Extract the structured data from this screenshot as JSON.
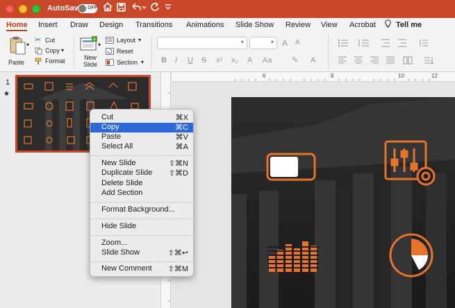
{
  "titlebar": {
    "autosave_label": "AutoSave",
    "toggle_state": "OFF"
  },
  "tabs": [
    {
      "label": "Home",
      "active": true
    },
    {
      "label": "Insert"
    },
    {
      "label": "Draw"
    },
    {
      "label": "Design"
    },
    {
      "label": "Transitions"
    },
    {
      "label": "Animations"
    },
    {
      "label": "Slide Show"
    },
    {
      "label": "Review"
    },
    {
      "label": "View"
    },
    {
      "label": "Acrobat"
    },
    {
      "label": "Tell me"
    }
  ],
  "ribbon": {
    "paste": "Paste",
    "cut": "Cut",
    "copy": "Copy",
    "format": "Format",
    "new_slide": "New",
    "new_slide_2": "Slide",
    "layout": "Layout",
    "reset": "Reset",
    "section": "Section"
  },
  "ruler": {
    "marks": [
      "6",
      "8",
      "10",
      "12"
    ]
  },
  "pane": {
    "slide_number": "1",
    "star": "★"
  },
  "context_menu": {
    "items": [
      {
        "label": "Cut",
        "shortcut": "⌘X"
      },
      {
        "label": "Copy",
        "shortcut": "⌘C",
        "selected": true
      },
      {
        "label": "Paste",
        "shortcut": "⌘V"
      },
      {
        "label": "Select All",
        "shortcut": "⌘A"
      },
      {
        "label": "New Slide",
        "shortcut": "⇧⌘N"
      },
      {
        "label": "Duplicate Slide",
        "shortcut": "⇧⌘D"
      },
      {
        "label": "Delete Slide",
        "shortcut": ""
      },
      {
        "label": "Add Section",
        "shortcut": ""
      },
      {
        "label": "Format Background...",
        "shortcut": ""
      },
      {
        "label": "Hide Slide",
        "shortcut": ""
      },
      {
        "label": "Zoom...",
        "shortcut": ""
      },
      {
        "label": "Slide Show",
        "shortcut": "⇧⌘↩"
      },
      {
        "label": "New Comment",
        "shortcut": "⇧⌘M"
      }
    ]
  },
  "colors": {
    "accent": "#c9482a",
    "icon_orange": "#e8742c",
    "menu_selection": "#2f68d8"
  }
}
